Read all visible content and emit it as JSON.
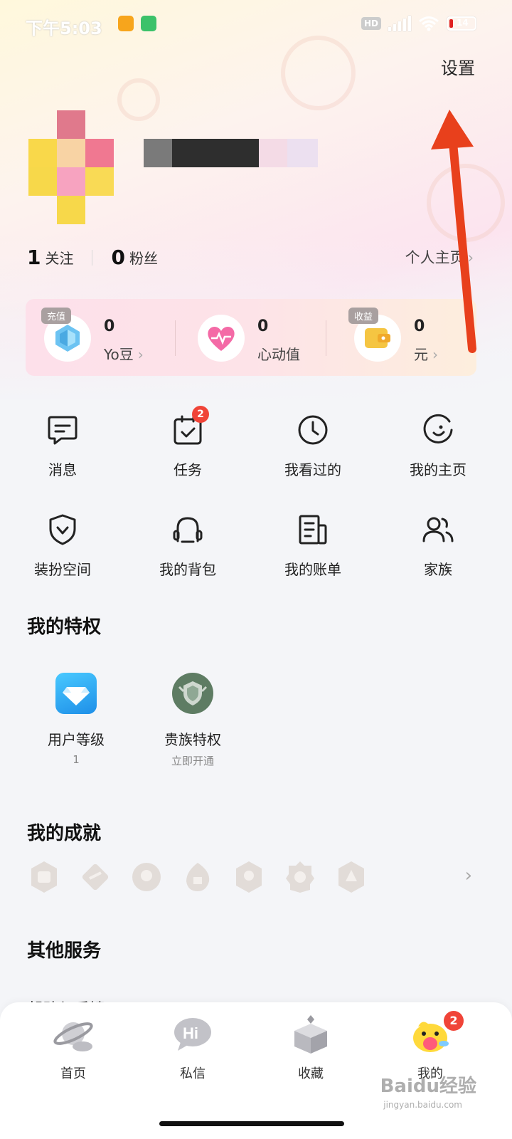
{
  "status_bar": {
    "time": "下午5:03",
    "hd_label": "HD",
    "battery": "14"
  },
  "header": {
    "settings_label": "设置"
  },
  "profile": {
    "follow_count": "1",
    "follow_label": "关注",
    "fans_count": "0",
    "fans_label": "粉丝",
    "homepage_label": "个人主页"
  },
  "wallet": [
    {
      "badge": "充值",
      "value": "0",
      "label": "Yo豆",
      "icon": "diamond-icon"
    },
    {
      "badge": "",
      "value": "0",
      "label": "心动值",
      "icon": "heart-icon"
    },
    {
      "badge": "收益",
      "value": "0",
      "label": "元",
      "icon": "wallet-icon"
    }
  ],
  "grid": [
    {
      "label": "消息",
      "icon": "message-icon"
    },
    {
      "label": "任务",
      "icon": "task-icon",
      "badge": "2"
    },
    {
      "label": "我看过的",
      "icon": "clock-icon"
    },
    {
      "label": "我的主页",
      "icon": "smile-icon"
    },
    {
      "label": "装扮空间",
      "icon": "shield-icon"
    },
    {
      "label": "我的背包",
      "icon": "backpack-icon"
    },
    {
      "label": "我的账单",
      "icon": "bill-icon"
    },
    {
      "label": "家族",
      "icon": "family-icon"
    }
  ],
  "privileges": {
    "title": "我的特权",
    "items": [
      {
        "label": "用户等级",
        "sub": "1",
        "icon": "diamond-level-icon"
      },
      {
        "label": "贵族特权",
        "sub": "立即开通",
        "icon": "noble-badge-icon"
      }
    ]
  },
  "achievements": {
    "title": "我的成就",
    "count": 7
  },
  "other_services": {
    "title": "其他服务",
    "cutoff_item": "帮助与反馈"
  },
  "tabbar": [
    {
      "label": "首页",
      "icon": "planet-icon"
    },
    {
      "label": "私信",
      "icon": "hi-bubble-icon"
    },
    {
      "label": "收藏",
      "icon": "box-icon"
    },
    {
      "label": "我的",
      "icon": "duck-avatar-icon",
      "badge": "2"
    }
  ],
  "watermark": {
    "text": "Baidu经验",
    "sub": "jingyan.baidu.com"
  },
  "colors": {
    "accent_red": "#f04438",
    "annotation_arrow": "#e8401c"
  }
}
